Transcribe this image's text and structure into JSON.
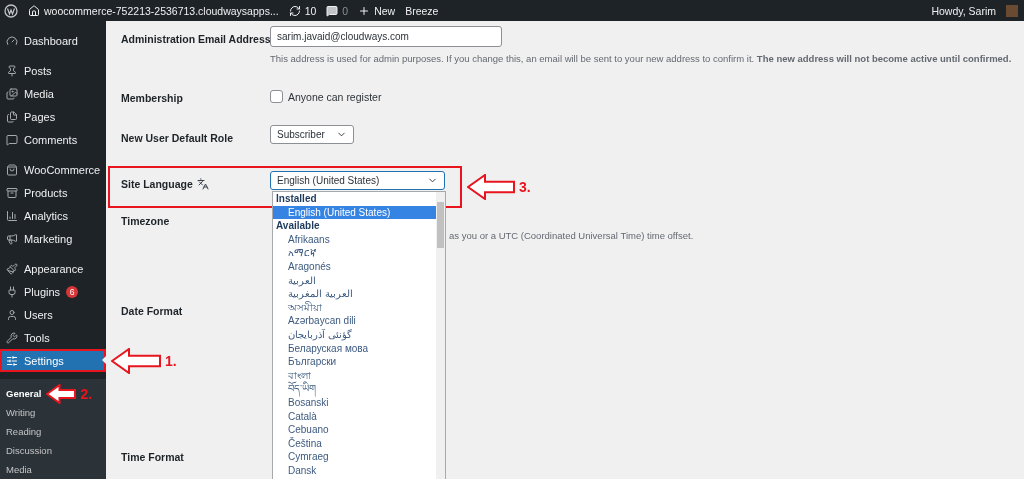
{
  "top_bar": {
    "site_name": "woocommerce-752213-2536713.cloudwaysapps...",
    "updates": "10",
    "comments": "0",
    "new_label": "New",
    "plugin_label": "Breeze",
    "greeting": "Howdy, Sarim"
  },
  "sidebar": {
    "groups": [
      [
        {
          "label": "Dashboard",
          "selected": false
        }
      ],
      [
        {
          "label": "Posts",
          "selected": false
        },
        {
          "label": "Media",
          "selected": false
        },
        {
          "label": "Pages",
          "selected": false
        },
        {
          "label": "Comments",
          "selected": false
        }
      ],
      [
        {
          "label": "WooCommerce",
          "selected": false
        },
        {
          "label": "Products",
          "selected": false
        },
        {
          "label": "Analytics",
          "selected": false
        },
        {
          "label": "Marketing",
          "selected": false
        }
      ],
      [
        {
          "label": "Appearance",
          "selected": false
        },
        {
          "label": "Plugins",
          "selected": false,
          "badge": "6"
        },
        {
          "label": "Users",
          "selected": false
        },
        {
          "label": "Tools",
          "selected": false
        },
        {
          "label": "Settings",
          "selected": true,
          "annotation": "1."
        }
      ]
    ],
    "submenu": [
      {
        "label": "General",
        "selected": true,
        "annotation": "2."
      },
      {
        "label": "Writing",
        "selected": false
      },
      {
        "label": "Reading",
        "selected": false
      },
      {
        "label": "Discussion",
        "selected": false
      },
      {
        "label": "Media",
        "selected": false
      }
    ]
  },
  "form": {
    "rows": [
      {
        "kind": "email",
        "label": "Administration Email Address",
        "value": "sarim.javaid@cloudways.com",
        "description": "This address is used for admin purposes. If you change this, an email will be sent to your new address to confirm it. **The new address will not become active until confirmed.**"
      },
      {
        "kind": "checkbox",
        "label": "Membership",
        "option": "Anyone can register",
        "checked": false
      },
      {
        "kind": "select",
        "label": "New User Default Role",
        "value": "Subscriber"
      },
      {
        "kind": "language",
        "label": "Site Language",
        "value": "English (United States)",
        "expanded": true,
        "annotation": "3.",
        "groups": [
          {
            "label": "Installed",
            "options": [
              {
                "label": "English (United States)",
                "selected": true
              }
            ]
          },
          {
            "label": "Available",
            "options": [
              {
                "label": "Afrikaans",
                "selected": false
              },
              {
                "label": "አማርኛ",
                "selected": false
              },
              {
                "label": "Aragonés",
                "selected": false
              },
              {
                "label": "العربية",
                "selected": false
              },
              {
                "label": "العربية المغربية",
                "selected": false
              },
              {
                "label": "অসমীয়া",
                "selected": false
              },
              {
                "label": "Azərbaycan dili",
                "selected": false
              },
              {
                "label": "گؤنئی آذربایجان",
                "selected": false
              },
              {
                "label": "Беларуская мова",
                "selected": false
              },
              {
                "label": "Български",
                "selected": false
              },
              {
                "label": "বাংলা",
                "selected": false
              },
              {
                "label": "བོད་ཡིག",
                "selected": false
              },
              {
                "label": "Bosanski",
                "selected": false
              },
              {
                "label": "Català",
                "selected": false
              },
              {
                "label": "Cebuano",
                "selected": false
              },
              {
                "label": "Čeština",
                "selected": false
              },
              {
                "label": "Cymraeg",
                "selected": false
              },
              {
                "label": "Dansk",
                "selected": false
              }
            ]
          }
        ]
      },
      {
        "kind": "timezone",
        "label": "Timezone",
        "description": "as you or a UTC (Coordinated Universal Time) time offset."
      },
      {
        "kind": "plain",
        "label": "Date Format"
      },
      {
        "kind": "plain",
        "label": "Time Format"
      }
    ]
  }
}
